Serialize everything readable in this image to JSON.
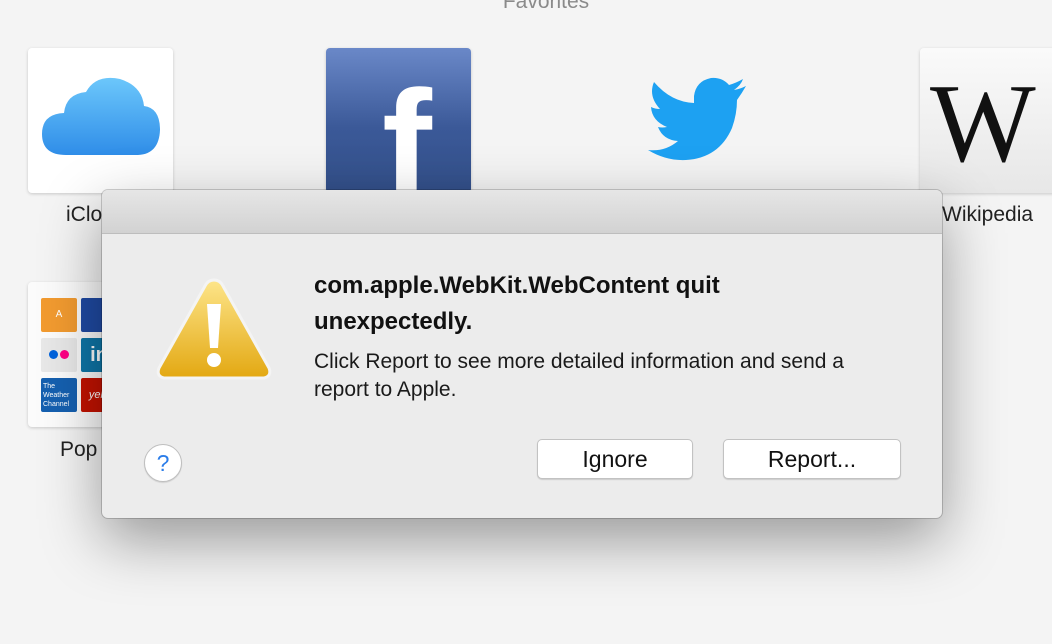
{
  "favorites": {
    "heading": "Favorites",
    "tiles": [
      {
        "label": "iClo",
        "icon": "icloud-icon"
      },
      {
        "label": "",
        "icon": "facebook-icon"
      },
      {
        "label": "",
        "icon": "twitter-icon"
      },
      {
        "label": "Wikipedia",
        "icon": "wikipedia-icon",
        "glyph": "W"
      },
      {
        "label": "Pop",
        "icon": "popular-grid-icon"
      }
    ],
    "facebook_glyph": "f",
    "popular_minis": [
      "A",
      "",
      "",
      "in",
      "The Weather Channel",
      "yelp"
    ]
  },
  "dialog": {
    "title": "com.apple.WebKit.WebContent quit unexpectedly.",
    "message": "Click Report to see more detailed information and send a report to Apple.",
    "help_label": "?",
    "ignore_label": "Ignore",
    "report_label": "Report...",
    "icon": "warning-icon"
  },
  "colors": {
    "facebook_blue": "#3b5998",
    "twitter_blue": "#1da1f2",
    "icloud_blue": "#3aa2ee",
    "warning_yellow": "#f2c230",
    "help_blue": "#2b7de9"
  }
}
